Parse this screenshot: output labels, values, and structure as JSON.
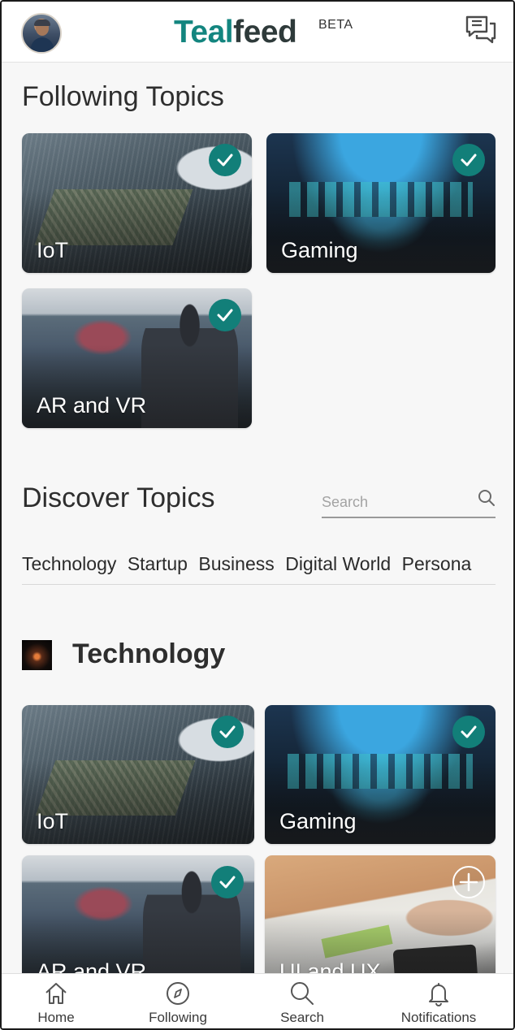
{
  "header": {
    "logo_part1": "Teal",
    "logo_part2": "feed",
    "badge": "BETA",
    "avatar": "user-avatar",
    "messages_icon": "chat-bubbles-icon"
  },
  "following": {
    "title": "Following Topics",
    "cards": [
      {
        "label": "IoT",
        "state": "following"
      },
      {
        "label": "Gaming",
        "state": "following"
      },
      {
        "label": "AR and VR",
        "state": "following"
      }
    ]
  },
  "discover": {
    "title": "Discover Topics",
    "search_placeholder": "Search",
    "tabs": [
      "Technology",
      "Startup",
      "Business",
      "Digital World",
      "Persona"
    ]
  },
  "technology": {
    "title": "Technology",
    "cards": [
      {
        "label": "IoT",
        "state": "following"
      },
      {
        "label": "Gaming",
        "state": "following"
      },
      {
        "label": "AR and VR",
        "state": "following"
      },
      {
        "label": "UI and UX",
        "state": "add"
      }
    ]
  },
  "bottom_nav": {
    "items": [
      {
        "label": "Home",
        "icon": "home-icon"
      },
      {
        "label": "Following",
        "icon": "compass-icon"
      },
      {
        "label": "Search",
        "icon": "search-icon"
      },
      {
        "label": "Notifications",
        "icon": "bell-icon"
      }
    ]
  },
  "colors": {
    "accent": "#13857f",
    "badge": "#127f79",
    "background": "#f7f7f7"
  }
}
